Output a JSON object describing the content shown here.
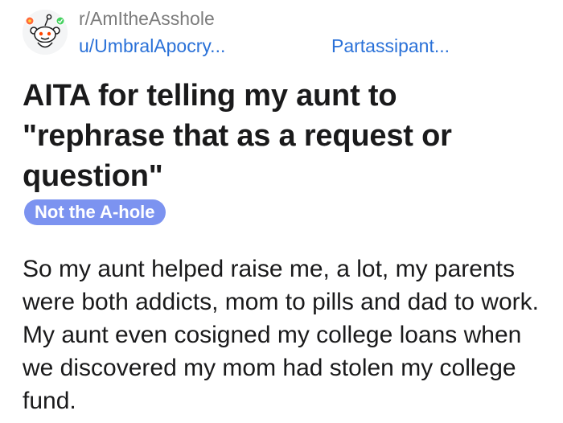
{
  "post": {
    "subreddit": "r/AmItheAsshole",
    "username": "u/UmbralApocry...",
    "user_flair": "Partassipant...",
    "title": "AITA for telling my aunt to \"rephrase that as a request or question\"",
    "link_flair": "Not the A-hole",
    "body": "So my aunt helped raise me, a lot, my parents were both addicts, mom to pills and dad to work. My aunt even cosigned my college loans when we discovered my mom had stolen my college fund."
  },
  "colors": {
    "username": "#2a71d8",
    "subreddit": "#7c7c7c",
    "flair_badge": "#7c93f0",
    "text": "#1a1a1b"
  },
  "icons": {
    "avatar": "snoo-avatar-icon"
  }
}
